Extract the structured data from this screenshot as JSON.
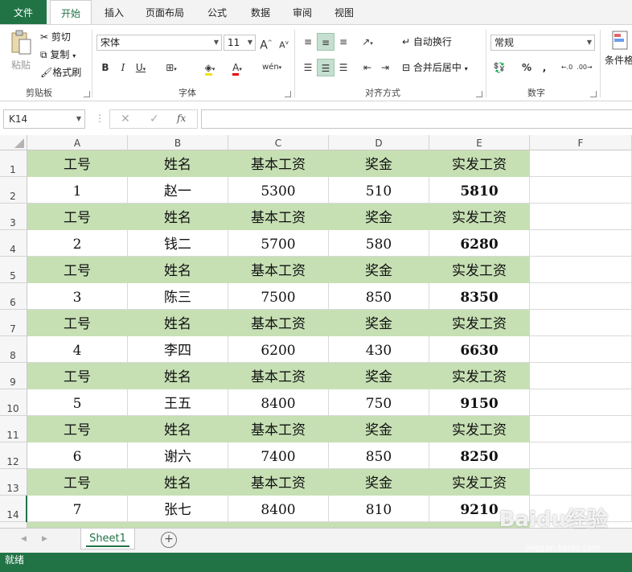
{
  "ribbon_tabs": [
    "文件",
    "开始",
    "插入",
    "页面布局",
    "公式",
    "数据",
    "审阅",
    "视图"
  ],
  "clipboard": {
    "paste": "粘贴",
    "cut": "剪切",
    "copy": "复制",
    "format_painter": "格式刷",
    "group": "剪贴板"
  },
  "font": {
    "name": "宋体",
    "size": "11",
    "group": "字体",
    "bold": "B",
    "italic": "I",
    "underline": "U",
    "increase": "A",
    "decrease": "A",
    "phonetic": "wén"
  },
  "alignment": {
    "wrap": "自动换行",
    "merge": "合并后居中",
    "group": "对齐方式"
  },
  "number": {
    "format": "常规",
    "group": "数字",
    "percent": "%",
    "comma": ","
  },
  "styles": {
    "conditional": "条件格"
  },
  "formula_bar": {
    "name_box": "K14",
    "fx": "fx",
    "cancel": "✕",
    "enter": "✓",
    "value": ""
  },
  "columns": [
    "A",
    "B",
    "C",
    "D",
    "E",
    "F"
  ],
  "row_numbers": [
    "1",
    "2",
    "3",
    "4",
    "5",
    "6",
    "7",
    "8",
    "9",
    "10",
    "11",
    "12",
    "13",
    "14"
  ],
  "header": [
    "工号",
    "姓名",
    "基本工资",
    "奖金",
    "实发工资"
  ],
  "records": [
    [
      "1",
      "赵一",
      "5300",
      "510",
      "5810"
    ],
    [
      "2",
      "钱二",
      "5700",
      "580",
      "6280"
    ],
    [
      "3",
      "陈三",
      "7500",
      "850",
      "8350"
    ],
    [
      "4",
      "李四",
      "6200",
      "430",
      "6630"
    ],
    [
      "5",
      "王五",
      "8400",
      "750",
      "9150"
    ],
    [
      "6",
      "谢六",
      "7400",
      "850",
      "8250"
    ],
    [
      "7",
      "张七",
      "8400",
      "810",
      "9210"
    ]
  ],
  "sheet_tab": "Sheet1",
  "add_sheet": "+",
  "status": "就绪",
  "watermark": "Baidu经验",
  "watermark_url": "jingyan.baidu.com",
  "colors": {
    "accent": "#217346",
    "header_fill": "#c6e0b4"
  }
}
